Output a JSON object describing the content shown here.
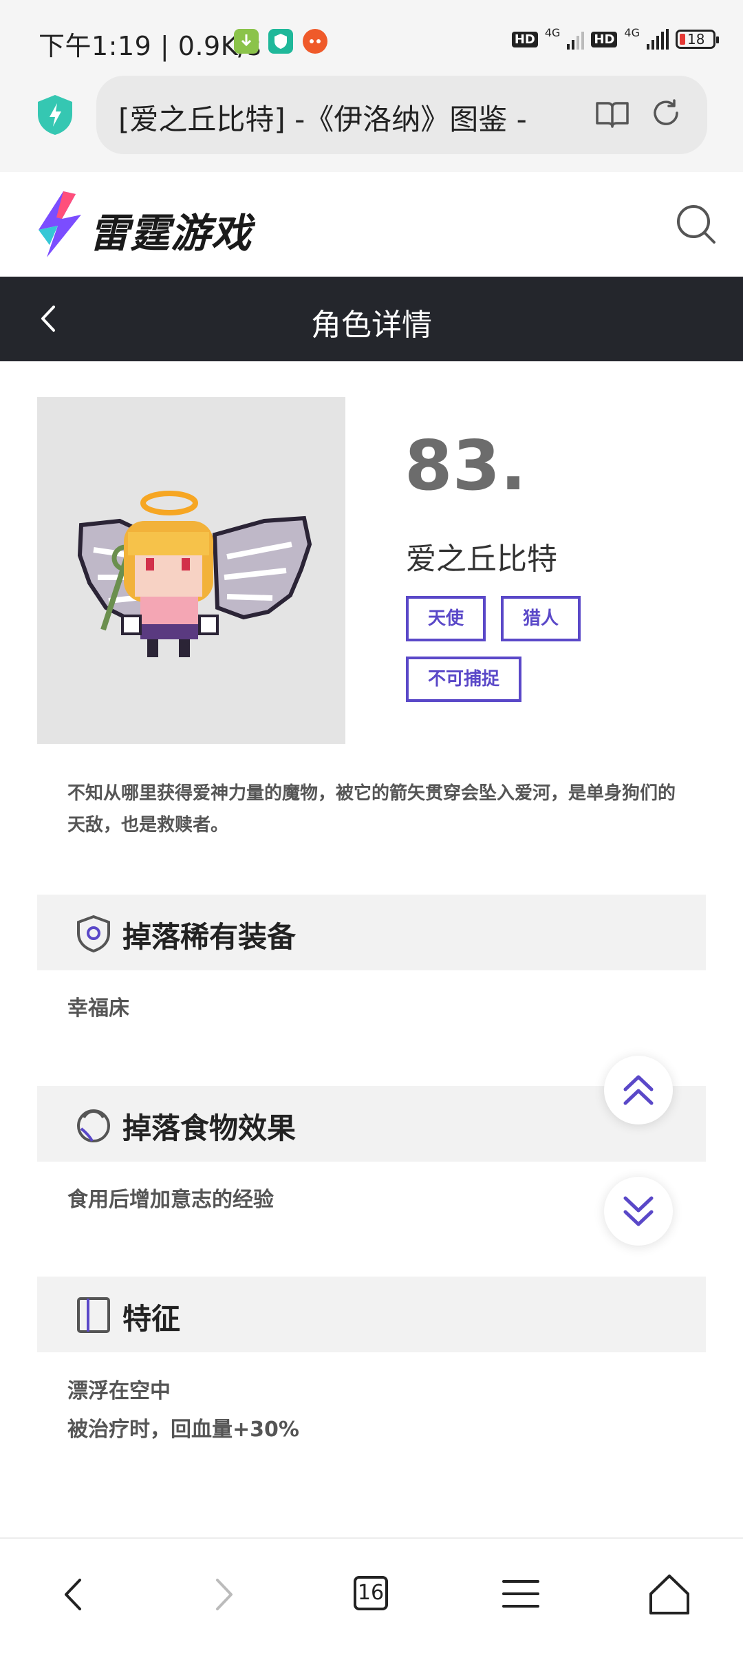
{
  "status_bar": {
    "time_speed": "下午1:19 | 0.9K/s",
    "hd1": "HD",
    "net1": "4G",
    "hd2": "HD",
    "net2": "4G",
    "battery": "18"
  },
  "browser": {
    "url_title": "[爱之丘比特] -《伊洛纳》图鉴 -"
  },
  "site": {
    "logo_text": "雷霆游戏"
  },
  "page": {
    "title": "角色详情"
  },
  "character": {
    "number": "83.",
    "name": "爱之丘比特",
    "tags": [
      "天使",
      "猎人",
      "不可捕捉"
    ],
    "description": "不知从哪里获得爱神力量的魔物，被它的箭矢贯穿会坠入爱河，是单身狗们的天敌，也是救赎者。"
  },
  "sections": {
    "rare_drop": {
      "title": "掉落稀有装备",
      "body": "幸福床"
    },
    "food_drop": {
      "title": "掉落食物效果",
      "body": "食用后增加意志的经验"
    },
    "traits": {
      "title": "特征",
      "lines": [
        "漂浮在空中",
        "被治疗时，回血量+30%"
      ]
    }
  },
  "bottom_nav": {
    "tab_count": "16"
  },
  "colors": {
    "accent": "#5a48c8",
    "title_bar": "#24262c"
  }
}
